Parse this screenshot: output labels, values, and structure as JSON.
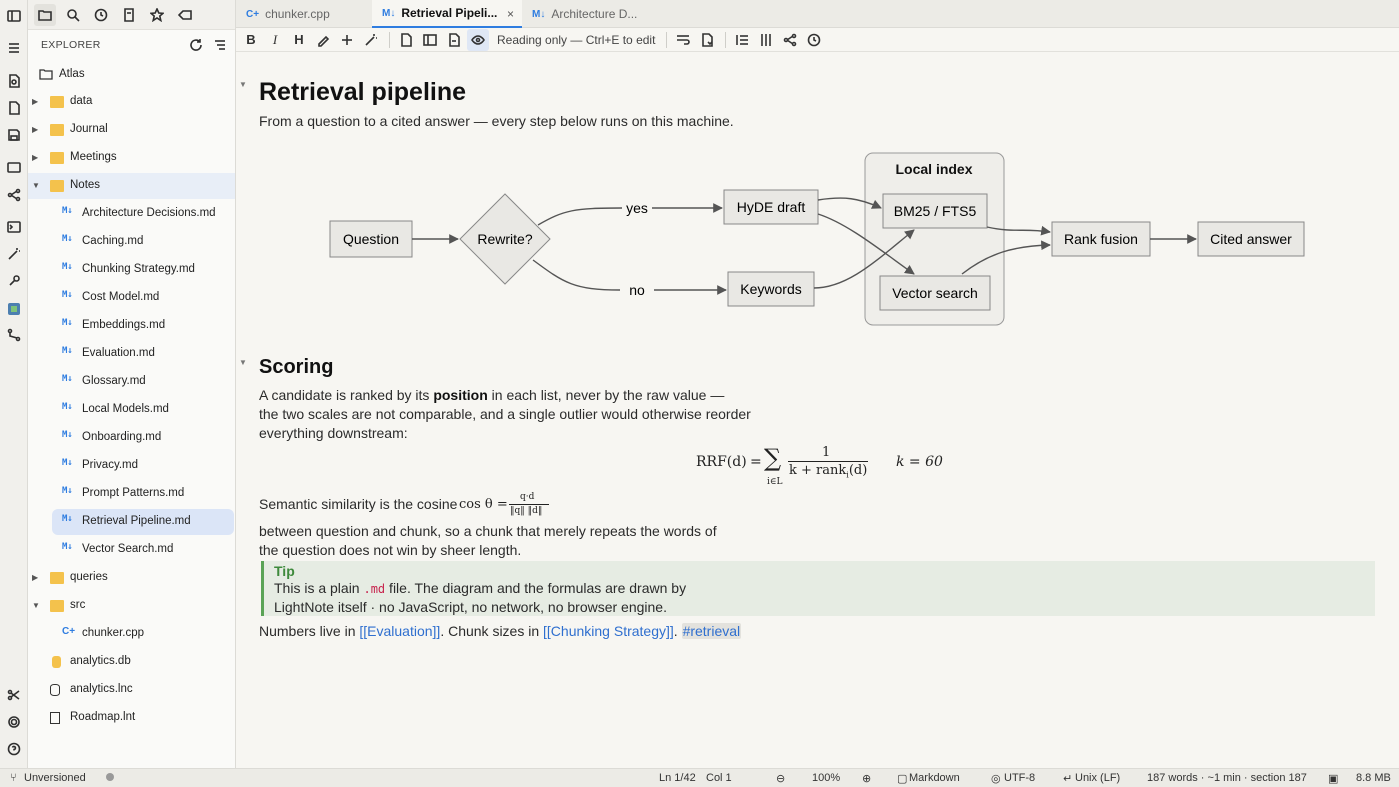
{
  "activity_bar": {
    "icons": [
      "sidebar-toggle-icon",
      "menu-icon",
      "new-note-icon",
      "new-file-icon",
      "save-icon",
      "window-icon",
      "graph-icon",
      "terminal-icon",
      "magic-wand-icon",
      "tools-icon",
      "app-icon",
      "git-icon",
      "scissors-icon",
      "settings-icon",
      "help-icon"
    ]
  },
  "explorer": {
    "title": "EXPLORER",
    "root": "Atlas",
    "items": [
      {
        "label": "data",
        "type": "folder"
      },
      {
        "label": "Journal",
        "type": "folder"
      },
      {
        "label": "Meetings",
        "type": "folder"
      },
      {
        "label": "Notes",
        "type": "folder-open"
      },
      {
        "label": "Architecture Decisions.md",
        "type": "md"
      },
      {
        "label": "Caching.md",
        "type": "md"
      },
      {
        "label": "Chunking Strategy.md",
        "type": "md"
      },
      {
        "label": "Cost Model.md",
        "type": "md"
      },
      {
        "label": "Embeddings.md",
        "type": "md"
      },
      {
        "label": "Evaluation.md",
        "type": "md"
      },
      {
        "label": "Glossary.md",
        "type": "md"
      },
      {
        "label": "Local Models.md",
        "type": "md"
      },
      {
        "label": "Onboarding.md",
        "type": "md"
      },
      {
        "label": "Privacy.md",
        "type": "md"
      },
      {
        "label": "Prompt Patterns.md",
        "type": "md"
      },
      {
        "label": "Retrieval Pipeline.md",
        "type": "md"
      },
      {
        "label": "Vector Search.md",
        "type": "md"
      },
      {
        "label": "queries",
        "type": "folder"
      },
      {
        "label": "src",
        "type": "folder-open"
      },
      {
        "label": "chunker.cpp",
        "type": "cpp"
      },
      {
        "label": "analytics.db",
        "type": "db"
      },
      {
        "label": "analytics.lnc",
        "type": "lnc"
      },
      {
        "label": "Roadmap.lnt",
        "type": "lnt"
      }
    ]
  },
  "tabs": [
    {
      "label": "chunker.cpp",
      "icon": "cpp-icon"
    },
    {
      "label": "Retrieval Pipeli...",
      "icon": "markdown-icon",
      "close": "×"
    },
    {
      "label": "Architecture D...",
      "icon": "markdown-icon"
    }
  ],
  "toolbar": {
    "bold": "B",
    "italic": "I",
    "heading": "H",
    "reading_mode": "Reading only — Ctrl+E to edit"
  },
  "document": {
    "title": "Retrieval pipeline",
    "intro": "From a question to a cited answer — every step below runs on this machine.",
    "diagram": {
      "question": "Question",
      "rewrite": "Rewrite?",
      "yes": "yes",
      "no": "no",
      "hyde": "HyDE draft",
      "keywords": "Keywords",
      "group": "Local index",
      "bm25": "BM25 / FTS5",
      "vector": "Vector search",
      "fusion": "Rank fusion",
      "answer": "Cited answer"
    },
    "scoring_heading": "Scoring",
    "scoring_p1_a": "A candidate is ranked by its ",
    "scoring_p1_b": "position",
    "scoring_p1_c": " in each list, never by the raw value —",
    "scoring_p1_d": "the two scales are not comparable, and a single outlier would otherwise reorder",
    "scoring_p1_e": "everything downstream:",
    "formula": {
      "lhs": "RRF(d)",
      "eq": "=",
      "sum": "∑",
      "sum_sub": "i∈L",
      "num": "1",
      "den": "k + rank",
      "den_sub": "i",
      "den_end": "(d)",
      "k": "k = 60"
    },
    "semantic_a": "Semantic similarity is the cosine",
    "cos_formula": {
      "lhs": "cos θ =",
      "num": "q·d",
      "den": "‖q‖ ‖d‖"
    },
    "semantic_b": "between question and chunk, so a chunk that merely repeats the words of",
    "semantic_c": "the question does not win by sheer length.",
    "tip": {
      "title": "Tip",
      "line1_a": "This is a plain ",
      "line1_code": ".md",
      "line1_b": " file. The diagram and the formulas are drawn by",
      "line2": "LightNote itself · no JavaScript, no network, no browser engine."
    },
    "links_a": "Numbers live in ",
    "link1": "[[Evaluation]]",
    "links_b": ". Chunk sizes in ",
    "link2": "[[Chunking Strategy]]",
    "links_c": ". ",
    "tag": "#retrieval"
  },
  "status": {
    "vcs": "Unversioned",
    "position": "Ln 1/42",
    "col": "Col 1",
    "zoom": "100%",
    "mode": "Markdown",
    "encoding": "UTF-8",
    "eol": "Unix (LF)",
    "stats": "187 words · ~1 min · section 187",
    "memory": "8.8 MB"
  }
}
